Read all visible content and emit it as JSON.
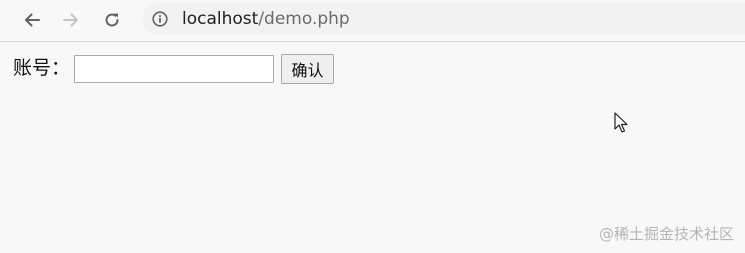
{
  "browser": {
    "url_host": "localhost",
    "url_path": "/demo.php",
    "icons": {
      "back": "back-arrow-icon",
      "forward": "forward-arrow-icon",
      "reload": "reload-icon",
      "site_info": "info-icon"
    }
  },
  "form": {
    "label": "账号：",
    "input_value": "",
    "button_label": "确认"
  },
  "watermark": "@稀土掘金技术社区"
}
